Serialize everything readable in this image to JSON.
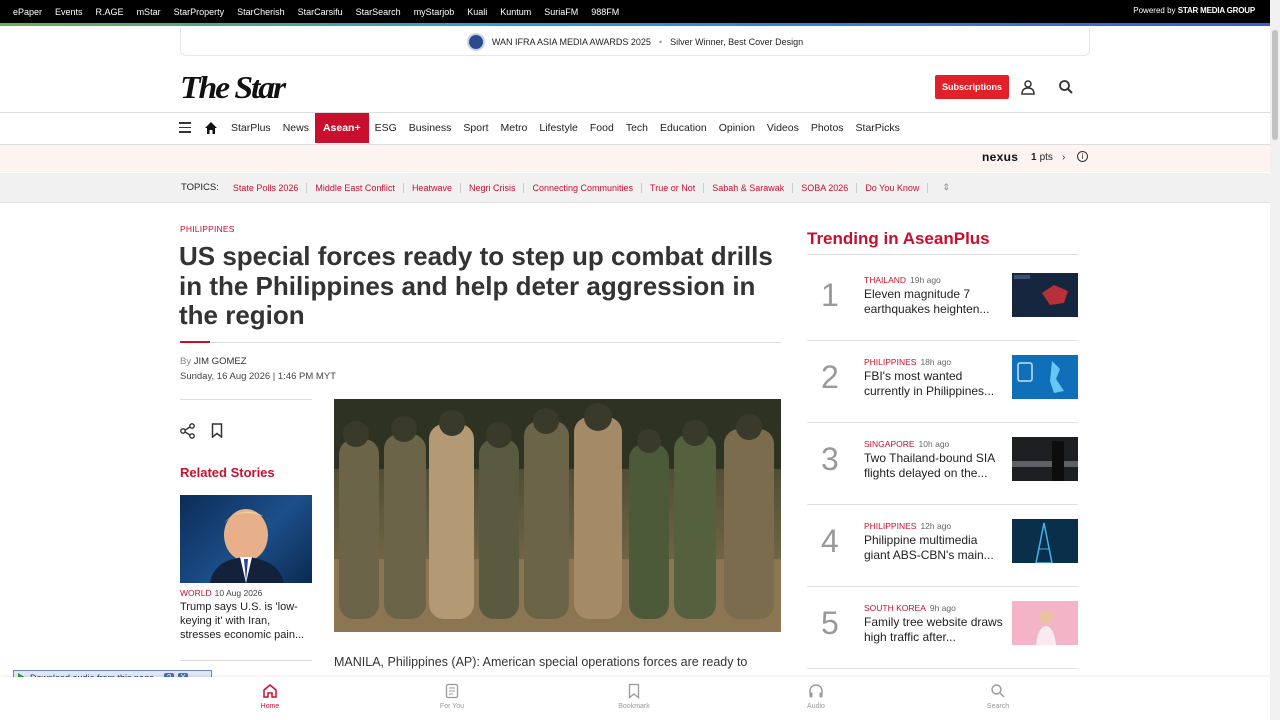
{
  "network_bar": {
    "links": [
      "ePaper",
      "Events",
      "R.AGE",
      "mStar",
      "StarProperty",
      "StarCherish",
      "StarCarsifu",
      "StarSearch",
      "myStarjob",
      "Kuali",
      "Kuntum",
      "SuriaFM",
      "988FM"
    ],
    "powered_by": "Powered by",
    "powered_brand": "STAR MEDIA GROUP"
  },
  "award_banner": {
    "title": "WAN IFRA ASIA MEDIA AWARDS 2025",
    "subtitle": "Silver Winner, Best Cover Design"
  },
  "header": {
    "logo_text": "The Star",
    "subscribe_label": "Subscriptions"
  },
  "nav": {
    "items": [
      "StarPlus",
      "News",
      "Asean+",
      "ESG",
      "Business",
      "Sport",
      "Metro",
      "Lifestyle",
      "Food",
      "Tech",
      "Education",
      "Opinion",
      "Videos",
      "Photos",
      "StarPicks"
    ],
    "active": "Asean+"
  },
  "nexus": {
    "brand": "nexus",
    "points_value": "1",
    "points_unit": "pts"
  },
  "topics": {
    "label": "TOPICS:",
    "items": [
      "State Polls 2026",
      "Middle East Conflict",
      "Heatwave",
      "Negri Crisis",
      "Connecting Communities",
      "True or Not",
      "Sabah & Sarawak",
      "SOBA 2026",
      "Do You Know"
    ]
  },
  "article": {
    "category": "PHILIPPINES",
    "headline": "US special forces ready to step up combat drills in the Philippines and help deter aggression in the region",
    "by": "By",
    "author": "JIM GOMEZ",
    "date": "Sunday, 16 Aug 2026 | 1:46 PM MYT",
    "lead": "MANILA, Philippines (AP): American special operations forces are ready to"
  },
  "related": {
    "title": "Related Stories",
    "items": [
      {
        "category": "WORLD",
        "date": "10 Aug 2026",
        "headline": "Trump says U.S. is 'low-keying it' with Iran, stresses economic pain..."
      }
    ]
  },
  "trending": {
    "title": "Trending in AseanPlus",
    "items": [
      {
        "rank": "1",
        "category": "THAILAND",
        "time": "19h ago",
        "title": "Eleven magnitude 7 earthquakes heighten..."
      },
      {
        "rank": "2",
        "category": "PHILIPPINES",
        "time": "18h ago",
        "title": "FBI's most wanted currently in Philippines..."
      },
      {
        "rank": "3",
        "category": "SINGAPORE",
        "time": "10h ago",
        "title": "Two Thailand-bound SIA flights delayed on the..."
      },
      {
        "rank": "4",
        "category": "PHILIPPINES",
        "time": "12h ago",
        "title": "Philippine multimedia giant ABS-CBN's main..."
      },
      {
        "rank": "5",
        "category": "SOUTH KOREA",
        "time": "9h ago",
        "title": "Family tree website draws high traffic after..."
      }
    ]
  },
  "audio_bar": {
    "label": "Download audio from this page",
    "help": "?",
    "close": "X"
  },
  "bottom_tabs": [
    {
      "label": "Home",
      "icon": "home-icon"
    },
    {
      "label": "For You",
      "icon": "for-you-icon"
    },
    {
      "label": "Bookmark",
      "icon": "bookmark-icon"
    },
    {
      "label": "Audio",
      "icon": "headphones-icon"
    },
    {
      "label": "Search",
      "icon": "search-icon"
    }
  ],
  "colors": {
    "brand_red": "#c8102e",
    "subscribe_red": "#e2202a"
  }
}
